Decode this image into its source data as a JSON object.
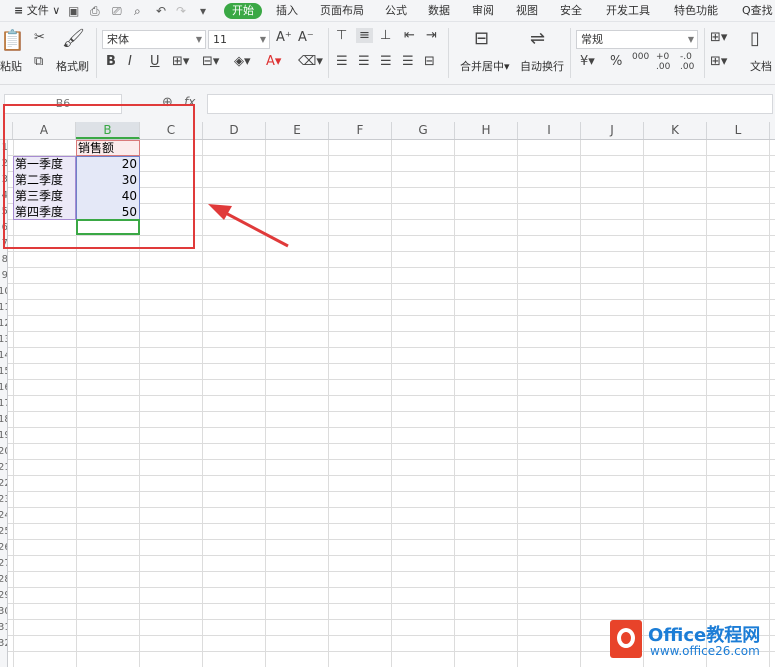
{
  "menubar": {
    "file_label": "文件",
    "tabs": [
      "开始",
      "插入",
      "页面布局",
      "公式",
      "数据",
      "审阅",
      "视图",
      "安全",
      "开发工具",
      "特色功能"
    ],
    "search_label": "Q查找"
  },
  "ribbon": {
    "paste_label": "粘贴",
    "format_painter_label": "格式刷",
    "font_name": "宋体",
    "font_size": "11",
    "merge_center_label": "合并居中",
    "wrap_text_label": "自动换行",
    "number_format": "常规",
    "doc_label": "文档"
  },
  "formula_bar": {
    "name_box": "B6",
    "fx_label": "fx",
    "formula": ""
  },
  "sheet": {
    "columns": [
      "A",
      "B",
      "C",
      "D",
      "E",
      "F",
      "G",
      "H",
      "I",
      "J",
      "K",
      "L"
    ],
    "rows": [
      "1",
      "2",
      "3",
      "4",
      "5",
      "6",
      "7",
      "8",
      "9",
      "10",
      "11",
      "12",
      "13",
      "14",
      "15",
      "16",
      "17",
      "18",
      "19",
      "20",
      "21",
      "22",
      "23",
      "24",
      "25",
      "26",
      "27",
      "28",
      "29",
      "30",
      "31",
      "32"
    ],
    "header_b1": "销售额",
    "quarters": [
      "第一季度",
      "第二季度",
      "第三季度",
      "第四季度"
    ],
    "sales": [
      "20",
      "30",
      "40",
      "50"
    ]
  },
  "watermark": {
    "brand": "Office教程网",
    "url": "www.office26.com"
  },
  "colors": {
    "accent": "#3aa845",
    "highlight": "#e03a3a",
    "brand": "#1c7dd6"
  }
}
